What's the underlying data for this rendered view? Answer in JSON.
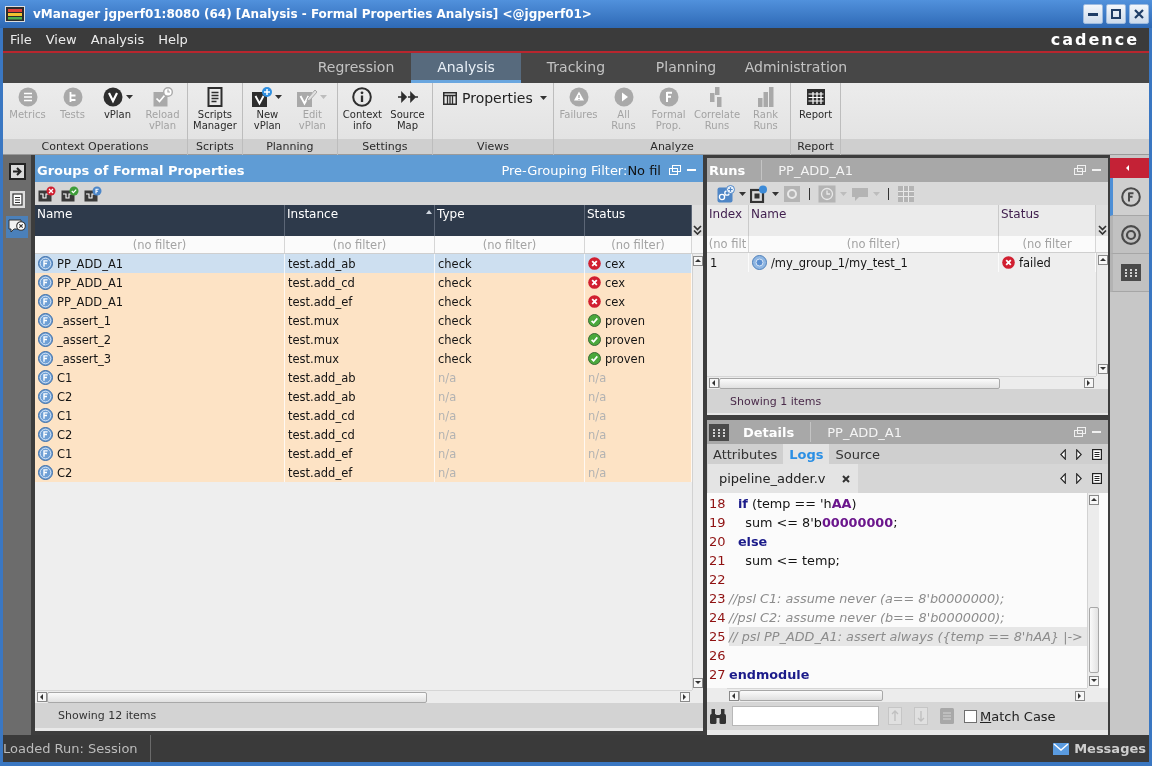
{
  "window": {
    "title": "vManager jgperf01:8080 (64) [Analysis - Formal Properties Analysis] <@jgperf01>"
  },
  "menu_bar": {
    "items": [
      "File",
      "View",
      "Analysis",
      "Help"
    ],
    "logo": "cadence"
  },
  "main_tabs": [
    {
      "label": "Regression",
      "selected": false
    },
    {
      "label": "Analysis",
      "selected": true
    },
    {
      "label": "Tracking",
      "selected": false
    },
    {
      "label": "Planning",
      "selected": false
    },
    {
      "label": "Administration",
      "selected": false
    }
  ],
  "toolbar": {
    "groups": [
      {
        "label": "Context Operations",
        "items": [
          {
            "kind": "metrics",
            "label": "Metrics",
            "disabled": true,
            "dropdown": false
          },
          {
            "kind": "tests",
            "label": "Tests",
            "disabled": true,
            "dropdown": false
          },
          {
            "kind": "vplan",
            "label": "vPlan",
            "disabled": false,
            "dropdown": true
          },
          {
            "kind": "reload",
            "label": "Reload vPlan",
            "disabled": true,
            "dropdown": false
          }
        ]
      },
      {
        "label": "Scripts",
        "items": [
          {
            "kind": "scripts",
            "label": "Scripts Manager",
            "disabled": false,
            "dropdown": false
          }
        ]
      },
      {
        "label": "Planning",
        "items": [
          {
            "kind": "newplan",
            "label": "New vPlan",
            "disabled": false,
            "dropdown": true
          },
          {
            "kind": "editplan",
            "label": "Edit vPlan",
            "disabled": true,
            "dropdown": true
          }
        ]
      },
      {
        "label": "Settings",
        "items": [
          {
            "kind": "info",
            "label": "Context info",
            "disabled": false,
            "dropdown": false
          },
          {
            "kind": "sourcemap",
            "label": "Source Map",
            "disabled": false,
            "dropdown": false
          }
        ]
      },
      {
        "label": "Views",
        "items": [
          {
            "kind": "select",
            "label": "Properties",
            "disabled": false,
            "dropdown": true
          }
        ]
      },
      {
        "label": "Analyze",
        "items": [
          {
            "kind": "failures",
            "label": "Failures",
            "disabled": true,
            "dropdown": false
          },
          {
            "kind": "allruns",
            "label": "All Runs",
            "disabled": true,
            "dropdown": false
          },
          {
            "kind": "formal",
            "label": "Formal Prop.",
            "disabled": true,
            "dropdown": false
          },
          {
            "kind": "correlate",
            "label": "Correlate Runs",
            "disabled": true,
            "dropdown": false
          },
          {
            "kind": "rank",
            "label": "Rank Runs",
            "disabled": true,
            "dropdown": false
          }
        ]
      },
      {
        "label": "Report",
        "items": [
          {
            "kind": "report",
            "label": "Report",
            "disabled": false,
            "dropdown": false
          }
        ]
      }
    ]
  },
  "left_rail": [
    {
      "kind": "import",
      "selected": false
    },
    {
      "kind": "document",
      "selected": false
    },
    {
      "kind": "comment",
      "selected": true
    }
  ],
  "properties_panel": {
    "title": "Groups of Formal Properties",
    "filter_label": "Pre-Grouping Filter:",
    "filter_value": "No fil",
    "columns": [
      {
        "label": "Name",
        "sorted": false
      },
      {
        "label": "Instance",
        "sorted": true
      },
      {
        "label": "Type",
        "sorted": false
      },
      {
        "label": "Status",
        "sorted": false
      }
    ],
    "filters": [
      "(no filter)",
      "(no filter)",
      "(no filter)",
      "(no filter)"
    ],
    "rows": [
      {
        "name": "PP_ADD_A1",
        "instance": "test.add_ab",
        "type": "check",
        "status": {
          "text": "cex",
          "kind": "fail"
        },
        "kind": "assertion",
        "selected": true
      },
      {
        "name": "PP_ADD_A1",
        "instance": "test.add_cd",
        "type": "check",
        "status": {
          "text": "cex",
          "kind": "fail"
        },
        "kind": "assertion",
        "selected": false
      },
      {
        "name": "PP_ADD_A1",
        "instance": "test.add_ef",
        "type": "check",
        "status": {
          "text": "cex",
          "kind": "fail"
        },
        "kind": "assertion",
        "selected": false
      },
      {
        "name": "_assert_1",
        "instance": "test.mux",
        "type": "check",
        "status": {
          "text": "proven",
          "kind": "pass"
        },
        "kind": "assertion",
        "selected": false
      },
      {
        "name": "_assert_2",
        "instance": "test.mux",
        "type": "check",
        "status": {
          "text": "proven",
          "kind": "pass"
        },
        "kind": "assertion",
        "selected": false
      },
      {
        "name": "_assert_3",
        "instance": "test.mux",
        "type": "check",
        "status": {
          "text": "proven",
          "kind": "pass"
        },
        "kind": "assertion",
        "selected": false
      },
      {
        "name": "C1",
        "instance": "test.add_ab",
        "type": "n/a",
        "status": {
          "text": "n/a",
          "kind": "none"
        },
        "kind": "constraint",
        "selected": false
      },
      {
        "name": "C2",
        "instance": "test.add_ab",
        "type": "n/a",
        "status": {
          "text": "n/a",
          "kind": "none"
        },
        "kind": "constraint",
        "selected": false
      },
      {
        "name": "C1",
        "instance": "test.add_cd",
        "type": "n/a",
        "status": {
          "text": "n/a",
          "kind": "none"
        },
        "kind": "constraint",
        "selected": false
      },
      {
        "name": "C2",
        "instance": "test.add_cd",
        "type": "n/a",
        "status": {
          "text": "n/a",
          "kind": "none"
        },
        "kind": "constraint",
        "selected": false
      },
      {
        "name": "C1",
        "instance": "test.add_ef",
        "type": "n/a",
        "status": {
          "text": "n/a",
          "kind": "none"
        },
        "kind": "constraint",
        "selected": false
      },
      {
        "name": "C2",
        "instance": "test.add_ef",
        "type": "n/a",
        "status": {
          "text": "n/a",
          "kind": "none"
        },
        "kind": "constraint",
        "selected": false
      }
    ],
    "footer": "Showing 12 items"
  },
  "runs_panel": {
    "title": "Runs",
    "context": "PP_ADD_A1",
    "toolbar": [
      {
        "kind": "addrun",
        "disabled": false,
        "dropdown": true
      },
      {
        "kind": "attach",
        "disabled": false,
        "dropdown": true
      },
      {
        "kind": "gear",
        "disabled": true,
        "dropdown": false
      },
      {
        "kind": "separator"
      },
      {
        "kind": "history",
        "disabled": true,
        "dropdown": true
      },
      {
        "kind": "comment",
        "disabled": true,
        "dropdown": true
      },
      {
        "kind": "separator"
      },
      {
        "kind": "grid",
        "disabled": true,
        "dropdown": false
      }
    ],
    "columns": [
      "Index",
      "Name",
      "Status"
    ],
    "filters": [
      "(no filt",
      "(no filter)",
      "(no filter"
    ],
    "rows": [
      {
        "index": "1",
        "name": "/my_group_1/my_test_1",
        "status": {
          "text": "failed",
          "kind": "fail"
        },
        "selected": false
      }
    ],
    "footer": "Showing 1 items"
  },
  "right_rail": [
    {
      "kind": "formal",
      "selected": true
    },
    {
      "kind": "target",
      "selected": false
    },
    {
      "kind": "keypad",
      "selected": false
    }
  ],
  "details_panel": {
    "title": "Details",
    "context": "PP_ADD_A1",
    "tabs": [
      {
        "label": "Attributes",
        "selected": false
      },
      {
        "label": "Logs",
        "selected": true
      },
      {
        "label": "Source",
        "selected": false
      }
    ],
    "file_tabs": [
      {
        "label": "pipeline_adder.v",
        "selected": true
      }
    ],
    "code": [
      {
        "number": "18",
        "highlighted": false,
        "segments": [
          {
            "text": "  if",
            "kind": "keyword"
          },
          {
            "text": " (temp == 'h",
            "kind": "plain"
          },
          {
            "text": "AA",
            "kind": "number"
          },
          {
            "text": ")",
            "kind": "plain"
          }
        ]
      },
      {
        "number": "19",
        "highlighted": false,
        "segments": [
          {
            "text": "    sum <= 8'b",
            "kind": "plain"
          },
          {
            "text": "00000000",
            "kind": "number"
          },
          {
            "text": ";",
            "kind": "plain"
          }
        ]
      },
      {
        "number": "20",
        "highlighted": false,
        "segments": [
          {
            "text": "  else",
            "kind": "keyword"
          }
        ]
      },
      {
        "number": "21",
        "highlighted": false,
        "segments": [
          {
            "text": "    sum <= temp;",
            "kind": "plain"
          }
        ]
      },
      {
        "number": "22",
        "highlighted": false
      },
      {
        "number": "23",
        "highlighted": false,
        "segments": [
          {
            "text": "//psl C1: assume never (a== 8'b0000000);",
            "kind": "comment"
          }
        ]
      },
      {
        "number": "24",
        "highlighted": false,
        "segments": [
          {
            "text": "//psl C2: assume never (b== 8'b0000000);",
            "kind": "comment"
          }
        ]
      },
      {
        "number": "25",
        "highlighted": true,
        "segments": [
          {
            "text": "// psl PP_ADD_A1: assert always ({temp == 8'hAA} |->",
            "kind": "comment"
          }
        ]
      },
      {
        "number": "26",
        "highlighted": false
      },
      {
        "number": "27",
        "highlighted": false,
        "segments": [
          {
            "text": "endmodule",
            "kind": "keyword"
          }
        ]
      }
    ],
    "match_case": {
      "label": "Match Case",
      "checked": false
    }
  },
  "status_bar": {
    "text": "Loaded Run: Session",
    "messages": "Messages"
  }
}
